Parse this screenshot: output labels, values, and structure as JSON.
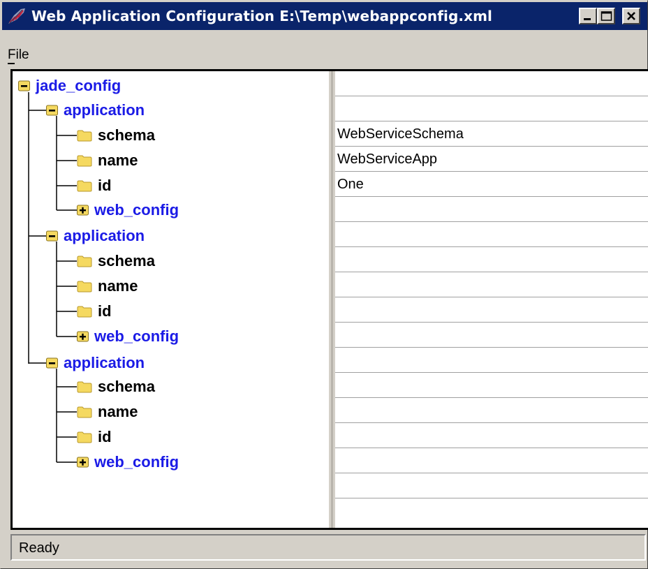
{
  "window": {
    "title": "Web Application Configuration E:\\Temp\\webappconfig.xml",
    "icon": "app-feather-icon"
  },
  "menu": {
    "file_label": "File",
    "file_mnemonic": "F"
  },
  "tree": {
    "root": "jade_config",
    "applications": [
      {
        "label": "application",
        "expanded": true,
        "children": [
          {
            "label": "schema",
            "value": "WebServiceSchema"
          },
          {
            "label": "name",
            "value": "WebServiceApp"
          },
          {
            "label": "id",
            "value": "One"
          },
          {
            "label": "web_config",
            "value": "",
            "expandable": true
          }
        ]
      },
      {
        "label": "application",
        "expanded": true,
        "children": [
          {
            "label": "schema",
            "value": ""
          },
          {
            "label": "name",
            "value": ""
          },
          {
            "label": "id",
            "value": ""
          },
          {
            "label": "web_config",
            "value": "",
            "expandable": true
          }
        ]
      },
      {
        "label": "application",
        "expanded": true,
        "children": [
          {
            "label": "schema",
            "value": ""
          },
          {
            "label": "name",
            "value": ""
          },
          {
            "label": "id",
            "value": ""
          },
          {
            "label": "web_config",
            "value": "",
            "expandable": true
          }
        ]
      }
    ]
  },
  "values": [
    "",
    "",
    "WebServiceSchema",
    "WebServiceApp",
    "One",
    "",
    "",
    "",
    "",
    "",
    "",
    "",
    "",
    "",
    "",
    "",
    ""
  ],
  "status": {
    "text": "Ready"
  },
  "colors": {
    "titlebar": "#0a246a",
    "node_blue": "#1b1be6",
    "folder_yellow": "#f5d960",
    "window_gray": "#d4d0c8"
  }
}
